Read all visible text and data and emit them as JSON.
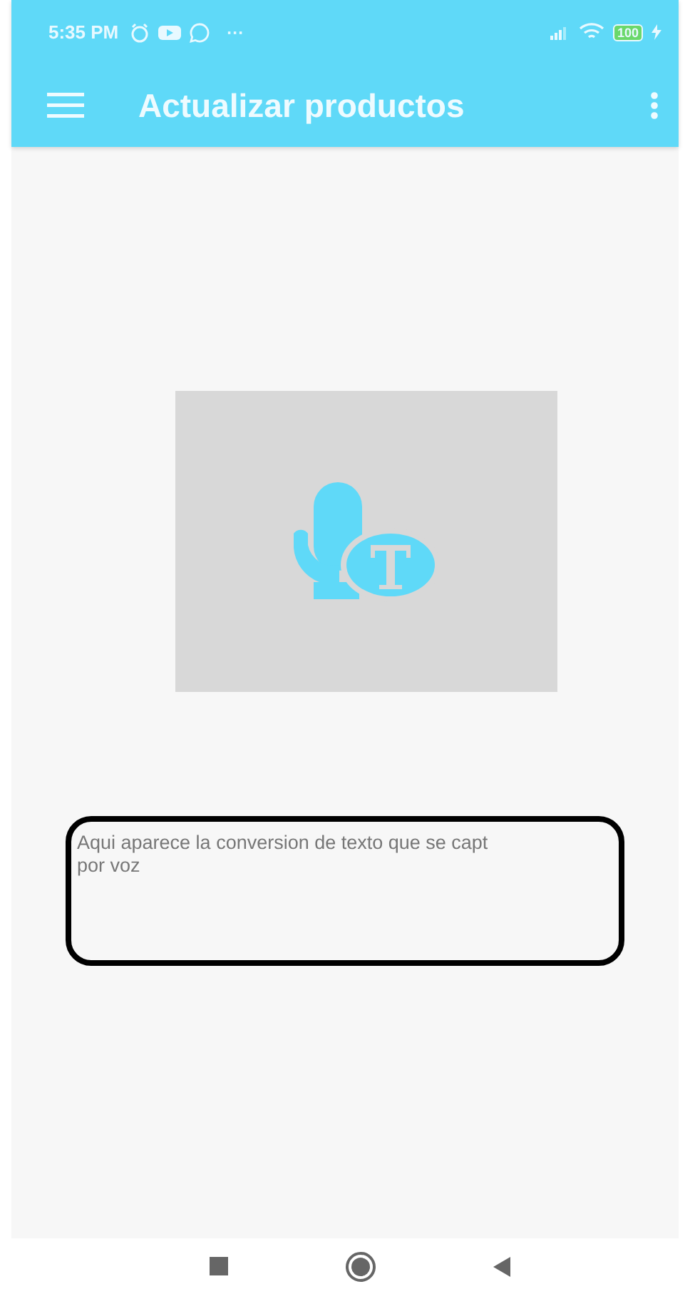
{
  "status_bar": {
    "time": "5:35 PM",
    "more": "···",
    "battery": "100"
  },
  "toolbar": {
    "title": "Actualizar productos"
  },
  "output_box": {
    "lines": [
      "Aqui aparece la conversion de texto que se capt",
      "por voz"
    ]
  }
}
